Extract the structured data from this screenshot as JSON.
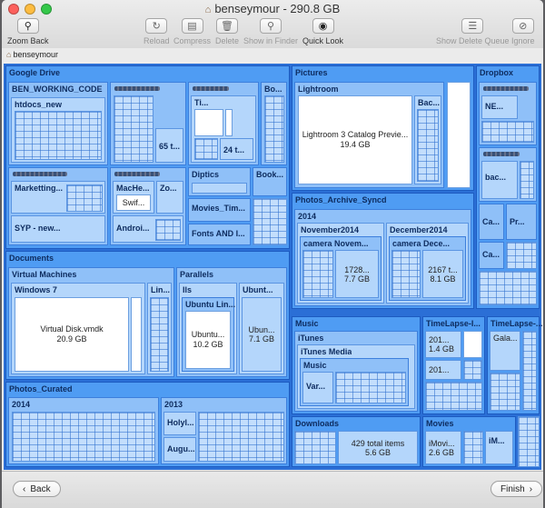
{
  "window": {
    "title": "benseymour - 290.8 GB",
    "breadcrumb": "benseymour"
  },
  "toolbar": {
    "zoom_back": "Zoom Back",
    "reload": "Reload",
    "compress": "Compress",
    "delete": "Delete",
    "show_in_finder": "Show in Finder",
    "quick_look": "Quick Look",
    "show_delete_queue": "Show Delete Queue",
    "ignore": "Ignore"
  },
  "treemap": {
    "google_drive": {
      "label": "Google Drive",
      "ben_working_code": "BEN_WORKING_CODE",
      "htdocs_new": "htdocs_new",
      "marketting": "Marketting...",
      "syp_new": "SYP - new...",
      "ti": "Ti...",
      "bo": "Bo...",
      "size_65": "65 t...",
      "size_24": "24 t...",
      "diptics": "Diptics",
      "book": "Book...",
      "movies_tim": "Movies_Tim...",
      "fonts_and": "Fonts AND I...",
      "mache": "MacHe...",
      "zo": "Zo...",
      "swif": "Swif...",
      "androi": "Androi..."
    },
    "pictures": {
      "label": "Pictures",
      "lightroom": "Lightroom",
      "lightroom_file": "Lightroom 3 Catalog Previe...",
      "lightroom_size": "19.4 GB",
      "bac": "Bac..."
    },
    "dropbox": {
      "label": "Dropbox",
      "ne": "NE...",
      "bac": "bac...",
      "ca1": "Ca...",
      "pr": "Pr...",
      "ca2": "Ca..."
    },
    "photos_archive": {
      "label": "Photos_Archive_Syncd",
      "year": "2014",
      "nov": "November2014",
      "nov_camera": "camera Novem...",
      "nov_items": "1728...",
      "nov_size": "7.7 GB",
      "dec": "December2014",
      "dec_camera": "camera Dece...",
      "dec_items": "2167 t...",
      "dec_size": "8.1 GB"
    },
    "documents": {
      "label": "Documents",
      "virtual_machines": "Virtual Machines",
      "windows7": "Windows 7",
      "vmdk_file": "Virtual Disk.vmdk",
      "vmdk_size": "20.9 GB",
      "lin": "Lin...",
      "parallels": "Parallels",
      "ils": "Ils",
      "ubuntu_lin": "Ubuntu Lin...",
      "ubuntu_file": "Ubuntu...",
      "ubuntu_size": "10.2 GB",
      "ubunt2": "Ubunt...",
      "ubun_file2": "Ubun...",
      "ubun_size2": "7.1 GB"
    },
    "music": {
      "label": "Music",
      "itunes": "iTunes",
      "itunes_media": "iTunes Media",
      "music": "Music",
      "var": "Var..."
    },
    "timelapse1": {
      "label": "TimeLapse-I...",
      "item1": "201...",
      "size1": "1.4 GB",
      "item2": "201..."
    },
    "timelapse2": {
      "label": "TimeLapse-...",
      "gala": "Gala..."
    },
    "photos_curated": {
      "label": "Photos_Curated",
      "y2014": "2014",
      "y2013": "2013",
      "holyl": "Holyl...",
      "augu": "Augu..."
    },
    "downloads": {
      "label": "Downloads",
      "items": "429 total items",
      "size": "5.6 GB"
    },
    "movies": {
      "label": "Movies",
      "imovi1": "iMovi...",
      "imovi1_size": "2.6 GB",
      "imovi2": "iM..."
    }
  },
  "buttons": {
    "back": "Back",
    "finish": "Finish"
  }
}
